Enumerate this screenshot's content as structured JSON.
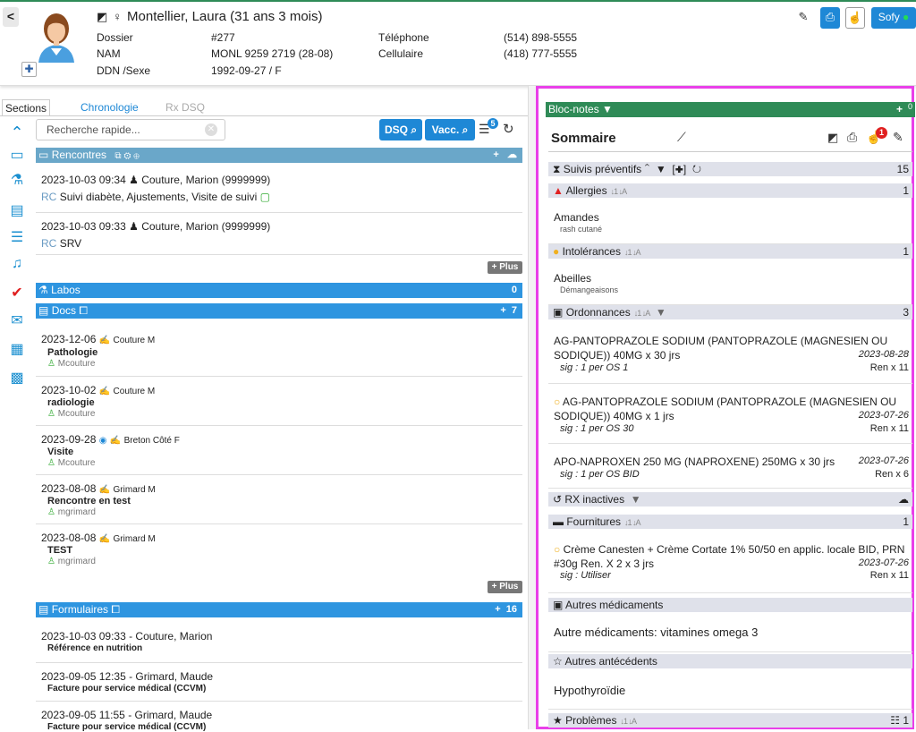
{
  "patient": {
    "name": "Montellier, Laura (31 ans 3 mois)",
    "fields": [
      {
        "label": "Dossier",
        "value": "#277"
      },
      {
        "label": "NAM",
        "value": "MONL 9259 2719 (28-08)"
      },
      {
        "label": "DDN /Sexe",
        "value": "1992-09-27 / F"
      }
    ],
    "contacts": [
      {
        "label": "Téléphone",
        "value": "(514) 898-5555"
      },
      {
        "label": "Cellulaire",
        "value": "(418) 777-5555"
      }
    ]
  },
  "header_actions": {
    "sofy_label": "Sofy"
  },
  "tabs": [
    {
      "label": "Sections"
    },
    {
      "label": "Chronologie"
    },
    {
      "label": "Rx DSQ"
    }
  ],
  "search": {
    "placeholder": "Recherche rapide..."
  },
  "buttons": {
    "dsq": "DSQ",
    "vacc": "Vacc.",
    "list_badge": "5"
  },
  "rencontres": {
    "title": "Rencontres",
    "items": [
      {
        "date": "2023-10-03 09:34",
        "who": "Couture, Marion (9999999)",
        "tag": "RC",
        "text": "Suivi diabète, Ajustements, Visite de suivi"
      },
      {
        "date": "2023-10-03 09:33",
        "who": "Couture, Marion (9999999)",
        "tag": "RC",
        "text": "SRV"
      }
    ],
    "more": "Plus"
  },
  "labos": {
    "title": "Labos",
    "count": "0"
  },
  "docs": {
    "title": "Docs",
    "count": "7",
    "items": [
      {
        "date": "2023-12-06",
        "author": "Couture M",
        "type": "Pathologie",
        "user": "Mcouture"
      },
      {
        "date": "2023-10-02",
        "author": "Couture M",
        "type": "radiologie",
        "user": "Mcouture"
      },
      {
        "date": "2023-09-28",
        "author": "Breton Côté F",
        "type": "Visite",
        "user": "Mcouture"
      },
      {
        "date": "2023-08-08",
        "author": "Grimard M",
        "type": "Rencontre en test",
        "user": "mgrimard"
      },
      {
        "date": "2023-08-08",
        "author": "Grimard M",
        "type": "TEST",
        "user": "mgrimard"
      }
    ],
    "more": "Plus"
  },
  "formulaires": {
    "title": "Formulaires",
    "count": "16",
    "items": [
      {
        "line": "2023-10-03 09:33 - Couture, Marion",
        "desc": "Référence en nutrition"
      },
      {
        "line": "2023-09-05 12:35 - Grimard, Maude",
        "desc": "Facture pour service médical (CCVM)"
      },
      {
        "line": "2023-09-05 11:55 - Grimard, Maude",
        "desc": "Facture pour service médical (CCVM)"
      }
    ]
  },
  "bloc_notes": {
    "title": "Bloc-notes",
    "count": "0"
  },
  "sommaire": {
    "title": "Sommaire",
    "alert_badge": "1"
  },
  "suivis": {
    "title": "Suivis préventifs",
    "count": "15"
  },
  "allergies": {
    "title": "Allergies",
    "count": "1",
    "items": [
      {
        "name": "Amandes",
        "detail": "rash cutané"
      }
    ]
  },
  "intolerances": {
    "title": "Intolérances",
    "count": "1",
    "items": [
      {
        "name": "Abeilles",
        "detail": "Démangeaisons"
      }
    ]
  },
  "ordonnances": {
    "title": "Ordonnances",
    "count": "3",
    "items": [
      {
        "l1": "AG-PANTOPRAZOLE SODIUM (PANTOPRAZOLE (MAGNESIEN OU",
        "l2": "SODIQUE)) 40MG x 30 jrs",
        "date": "2023-08-28",
        "sig": "sig : 1 per OS 1",
        "ren": "Ren x 11",
        "warn": false
      },
      {
        "l1": "AG-PANTOPRAZOLE SODIUM (PANTOPRAZOLE (MAGNESIEN OU",
        "l2": "SODIQUE)) 40MG x 1 jrs",
        "date": "2023-07-26",
        "sig": "sig : 1 per OS 30",
        "ren": "Ren x 11",
        "warn": true
      },
      {
        "l1": "APO-NAPROXEN 250 MG (NAPROXENE) 250MG x 30 jrs",
        "l2": "",
        "date": "2023-07-26",
        "sig": "sig : 1 per OS BID",
        "ren": "Ren x 6",
        "warn": false
      }
    ]
  },
  "rx_inactives": {
    "title": "RX inactives"
  },
  "fournitures": {
    "title": "Fournitures",
    "count": "1",
    "item": {
      "l1": "Crème Canesten + Crème Cortate 1% 50/50 en applic. locale BID, PRN",
      "l2": "#30g Ren. X 2 x 3 jrs",
      "date": "2023-07-26",
      "sig": "sig : Utiliser",
      "ren": "Ren x 11"
    }
  },
  "autres_meds": {
    "title": "Autres médicaments",
    "text": "Autre médicaments: vitamines omega 3"
  },
  "autres_ant": {
    "title": "Autres antécédents",
    "text": "Hypothyroïdie"
  },
  "problemes": {
    "title": "Problèmes",
    "count": "1"
  }
}
